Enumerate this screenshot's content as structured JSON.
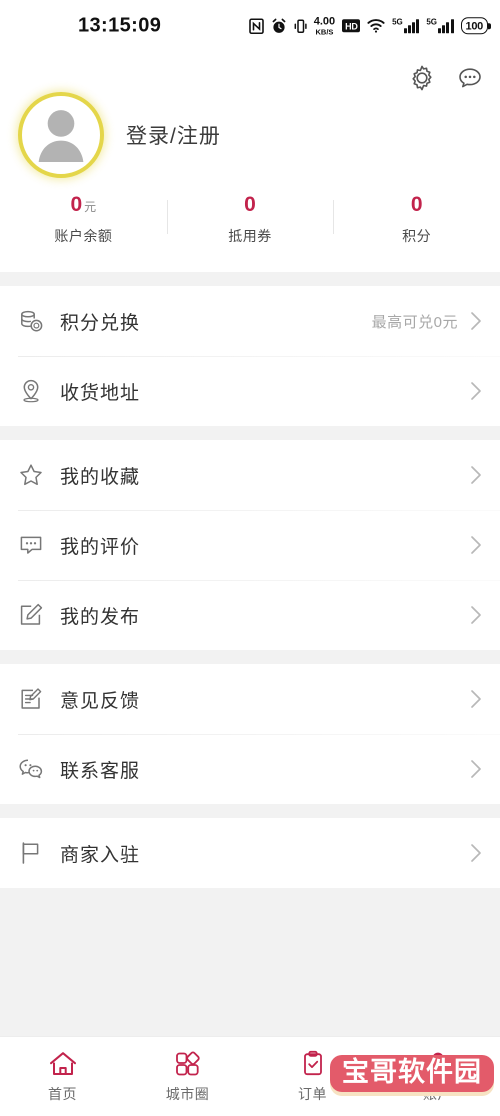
{
  "statusbar": {
    "time": "13:15:09",
    "netspeed_value": "4.00",
    "netspeed_unit": "KB/S",
    "hd_label": "HD",
    "sim1_label": "5G",
    "sim2_label": "5G",
    "battery": "100",
    "icons": [
      "nfc-icon",
      "alarm-icon",
      "vibrate-icon",
      "network-speed",
      "hd-icon",
      "wifi-icon",
      "signal-5g-icon",
      "signal-5g-icon",
      "battery-icon"
    ]
  },
  "header": {
    "settings_icon": "gear-icon",
    "message_icon": "chat-bubble-icon",
    "avatar_icon": "user-avatar-placeholder",
    "username": "登录/注册",
    "avatar_ring_color": "#e4d64a"
  },
  "stats": {
    "accent_color": "#c2234c",
    "items": [
      {
        "value": "0",
        "unit": "元",
        "label": "账户余额"
      },
      {
        "value": "0",
        "unit": "",
        "label": "抵用券"
      },
      {
        "value": "0",
        "unit": "",
        "label": "积分"
      }
    ]
  },
  "menu_groups": [
    {
      "rows": [
        {
          "icon": "coins-exchange-icon",
          "label": "积分兑换",
          "extra": "最高可兑0元"
        },
        {
          "icon": "location-pin-icon",
          "label": "收货地址",
          "extra": ""
        }
      ]
    },
    {
      "rows": [
        {
          "icon": "star-icon",
          "label": "我的收藏",
          "extra": ""
        },
        {
          "icon": "comment-icon",
          "label": "我的评价",
          "extra": ""
        },
        {
          "icon": "edit-square-icon",
          "label": "我的发布",
          "extra": ""
        }
      ]
    },
    {
      "rows": [
        {
          "icon": "feedback-note-icon",
          "label": "意见反馈",
          "extra": ""
        },
        {
          "icon": "wechat-icon",
          "label": "联系客服",
          "extra": ""
        }
      ]
    },
    {
      "rows": [
        {
          "icon": "flag-icon",
          "label": "商家入驻",
          "extra": ""
        }
      ]
    }
  ],
  "tabbar": {
    "accent_color": "#c2234c",
    "tabs": [
      {
        "icon": "home-icon",
        "label": "首页",
        "active": false
      },
      {
        "icon": "grid-shapes-icon",
        "label": "城市圈",
        "active": false
      },
      {
        "icon": "clipboard-check-icon",
        "label": "订单",
        "active": false
      },
      {
        "icon": "person-icon",
        "label": "账户",
        "active": true
      }
    ]
  },
  "watermark": {
    "text": "宝哥软件园",
    "bg_color": "#e35b6a"
  }
}
